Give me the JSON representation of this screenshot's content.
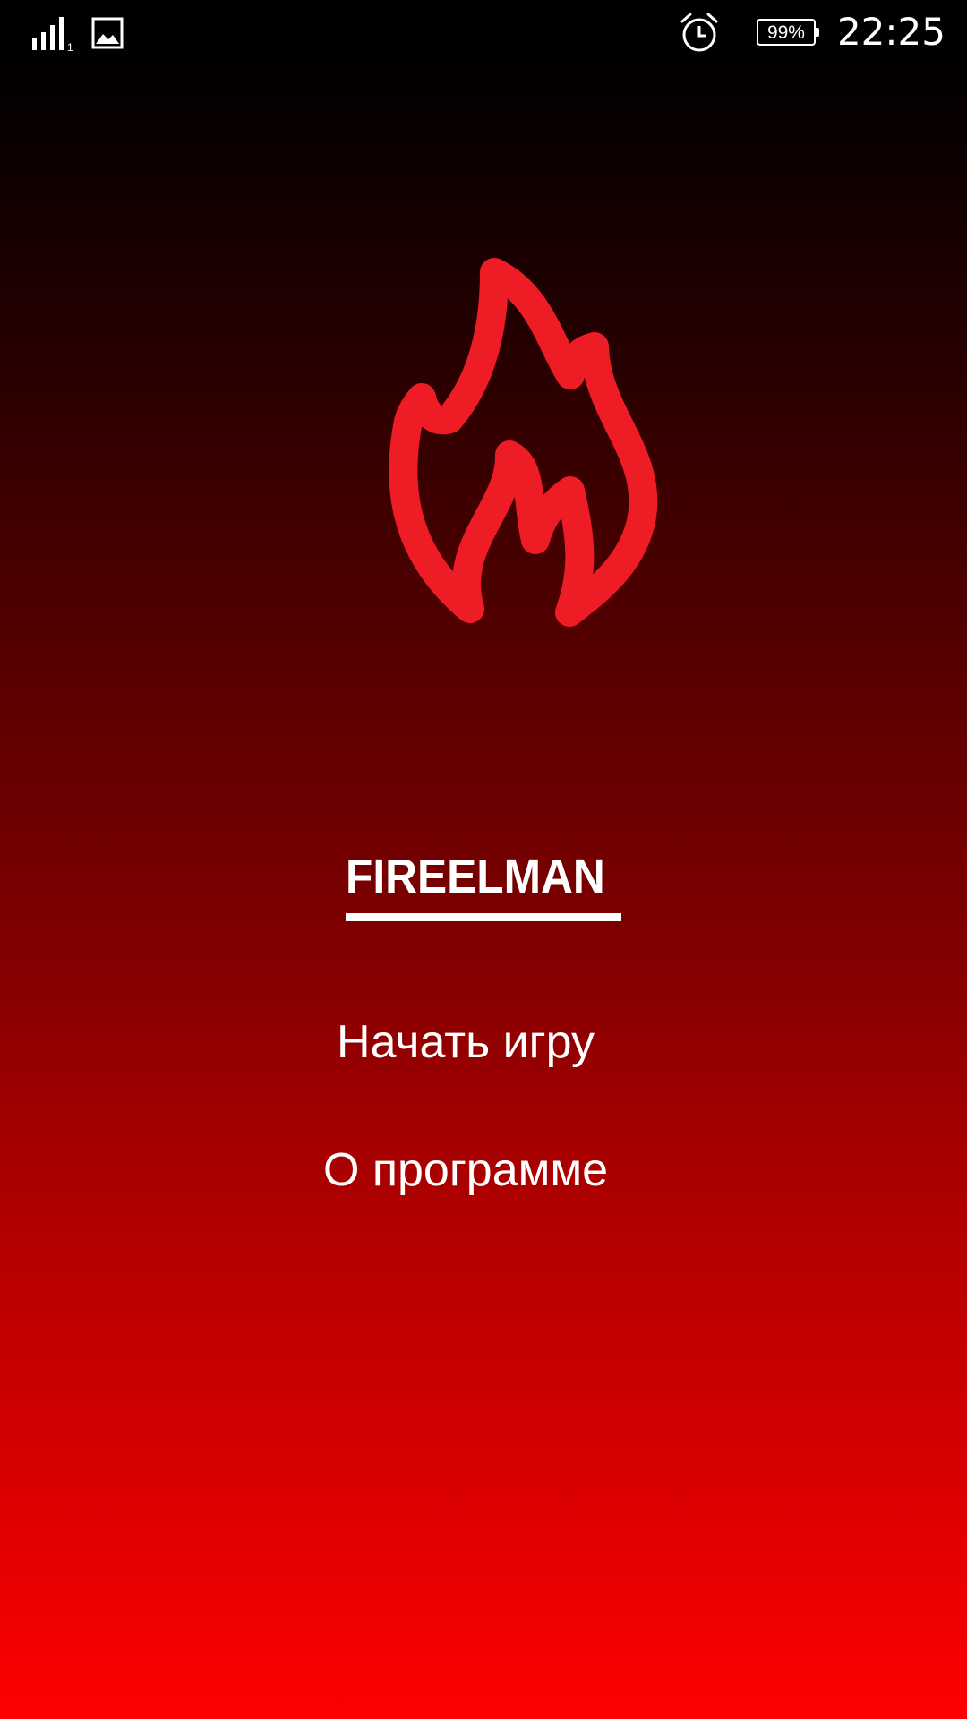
{
  "status_bar": {
    "signal_icon": "signal-bars-icon",
    "signal_sim": "1",
    "gallery_icon": "image-icon",
    "alarm_icon": "alarm-clock-icon",
    "battery_text": "99%",
    "time": "22:25"
  },
  "logo": {
    "icon": "flame-icon",
    "color": "#ee1c24"
  },
  "title": "FIREELMAN",
  "menu": {
    "start_label": "Начать игру",
    "about_label": "О программе"
  },
  "colors": {
    "background_top": "#000000",
    "background_bottom": "#ff0000",
    "text": "#ffffff"
  }
}
